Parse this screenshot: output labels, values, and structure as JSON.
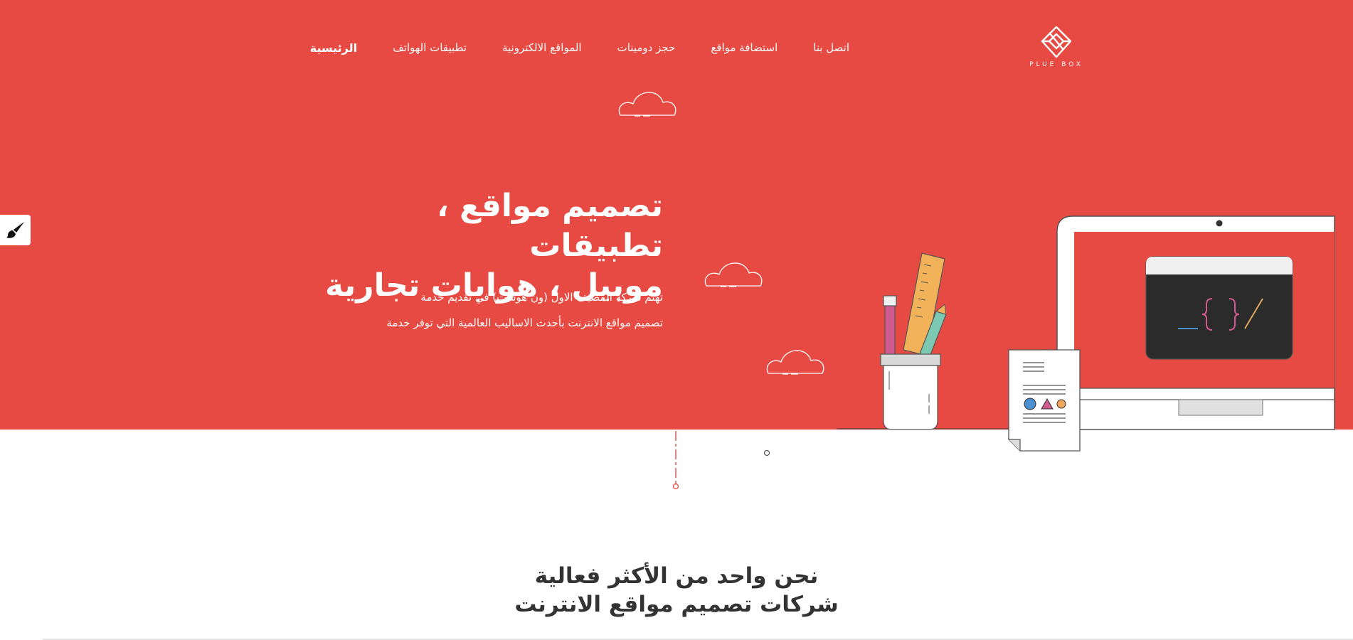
{
  "logo": {
    "text": "PLUE BOX",
    "icon": "diamond-logo-icon"
  },
  "nav": {
    "items": [
      {
        "label": "الرئيسية",
        "active": true
      },
      {
        "label": "تطبيقات الهواتف",
        "active": false
      },
      {
        "label": "المواقع الالكترونية",
        "active": false
      },
      {
        "label": "حجز دومينات",
        "active": false
      },
      {
        "label": "استضافة مواقع",
        "active": false
      },
      {
        "label": "اتصل بنا",
        "active": false
      }
    ]
  },
  "hero": {
    "title_line1": "تصميم مواقع ، تطبيقات",
    "title_line2": "موبيل ، هوايات تجارية",
    "desc_line1": "تهتم شركة المضيف الاول (ون هوست) في تقديم خدمة",
    "desc_line2": "تصميم مواقع الانترنت بأحدث الاساليب العالمية التي توفر خدمة"
  },
  "illustration": {
    "screen_code": "_{ }/",
    "icons": [
      "cloud-icon",
      "monitor-icon",
      "pencil-cup-icon",
      "ruler-icon",
      "document-icon"
    ]
  },
  "side_tool": {
    "icon": "paint-brush-icon"
  },
  "about": {
    "title_line1": "نحن واحد من الأكثر فعالية",
    "title_line2": "شركات تصميم مواقع الانترنت"
  },
  "colors": {
    "brand": "#e74a43",
    "white": "#ffffff",
    "dark_screen": "#2b2b2b"
  }
}
